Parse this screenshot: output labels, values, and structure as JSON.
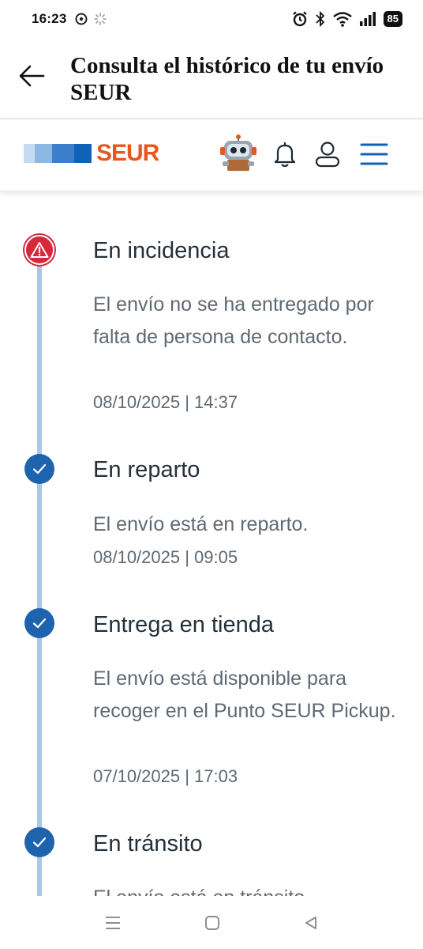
{
  "status_bar": {
    "time": "16:23",
    "battery": "85"
  },
  "app_bar": {
    "title": "Consulta el histórico de tu envío SEUR"
  },
  "brand": {
    "logo_text": "SEUR",
    "logo_color": "#e8561f",
    "bar_colors": [
      "#c4dbf1",
      "#7fb0e0",
      "#2a73c4",
      "#1261b8"
    ]
  },
  "colors": {
    "incident": "#d6283b",
    "done": "#1e63ad",
    "timeline_line": "#a9c9e6"
  },
  "events": [
    {
      "status": "incident",
      "icon": "warning-icon",
      "title": "En incidencia",
      "description": "El envío no se ha entregado por falta de persona de contacto.",
      "datetime": "08/10/2025 | 14:37"
    },
    {
      "status": "done",
      "icon": "check-icon",
      "title": "En reparto",
      "description": "El envío está en reparto.",
      "datetime": "08/10/2025 | 09:05"
    },
    {
      "status": "done",
      "icon": "check-icon",
      "title": "Entrega en tienda",
      "description": "El envío está disponible para recoger en el Punto SEUR Pickup.",
      "datetime": "07/10/2025 | 17:03"
    },
    {
      "status": "done",
      "icon": "check-icon",
      "title": "En tránsito",
      "description": "El envío está en tránsito"
    }
  ]
}
